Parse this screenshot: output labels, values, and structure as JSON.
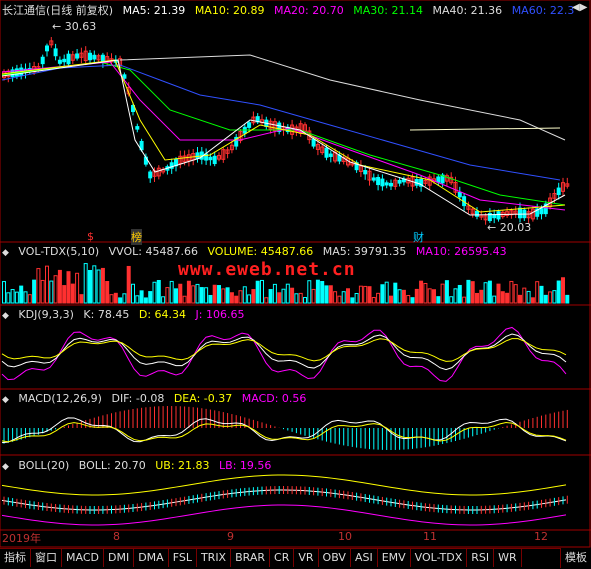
{
  "main_panel": {
    "title": "长江通信(日线 前复权)",
    "ma": [
      {
        "label": "MA5: 21.39",
        "color": "#ffffff"
      },
      {
        "label": "MA10: 20.89",
        "color": "#ffff00"
      },
      {
        "label": "MA20: 20.70",
        "color": "#ff00ff"
      },
      {
        "label": "MA30: 21.14",
        "color": "#00ff00"
      },
      {
        "label": "MA40: 21.36",
        "color": "#dddddd"
      },
      {
        "label": "MA60: 22.3",
        "color": "#0000ff"
      }
    ],
    "high_label": "30.63",
    "low_label": "20.03",
    "markers": [
      {
        "text": "$",
        "color": "#ff3030"
      },
      {
        "text": "榜",
        "color": "#ffcc00"
      },
      {
        "text": "财",
        "color": "#00ccff"
      }
    ]
  },
  "vol_panel": {
    "title": "VOL-TDX(5,10)",
    "vol": "VVOL: 45487.66",
    "volume": "VOLUME: 45487.66",
    "ma5": "MA5: 39791.35",
    "ma10": "MA10: 26595.43"
  },
  "kdj_panel": {
    "title": "KDJ(9,3,3)",
    "k": "K: 78.45",
    "d": "D: 64.34",
    "j": "J: 106.65"
  },
  "macd_panel": {
    "title": "MACD(12,26,9)",
    "dif": "DIF: -0.08",
    "dea": "DEA: -0.37",
    "macd": "MACD: 0.56"
  },
  "boll_panel": {
    "title": "BOLL(20)",
    "boll": "BOLL: 20.70",
    "ub": "UB: 21.83",
    "lb": "LB: 19.56"
  },
  "watermark": "www.eweb.net.cn",
  "x_axis": {
    "labels": [
      "2019年",
      "8",
      "9",
      "10",
      "11",
      "12"
    ]
  },
  "tabs": [
    "指标",
    "窗口",
    "MACD",
    "DMI",
    "DMA",
    "FSL",
    "TRIX",
    "BRAR",
    "CR",
    "VR",
    "OBV",
    "ASI",
    "EMV",
    "VOL-TDX",
    "RSI",
    "WR"
  ],
  "right_tab": "模板",
  "colors": {
    "up": "#ff3030",
    "down": "#00ffff",
    "frame": "#a00000"
  }
}
